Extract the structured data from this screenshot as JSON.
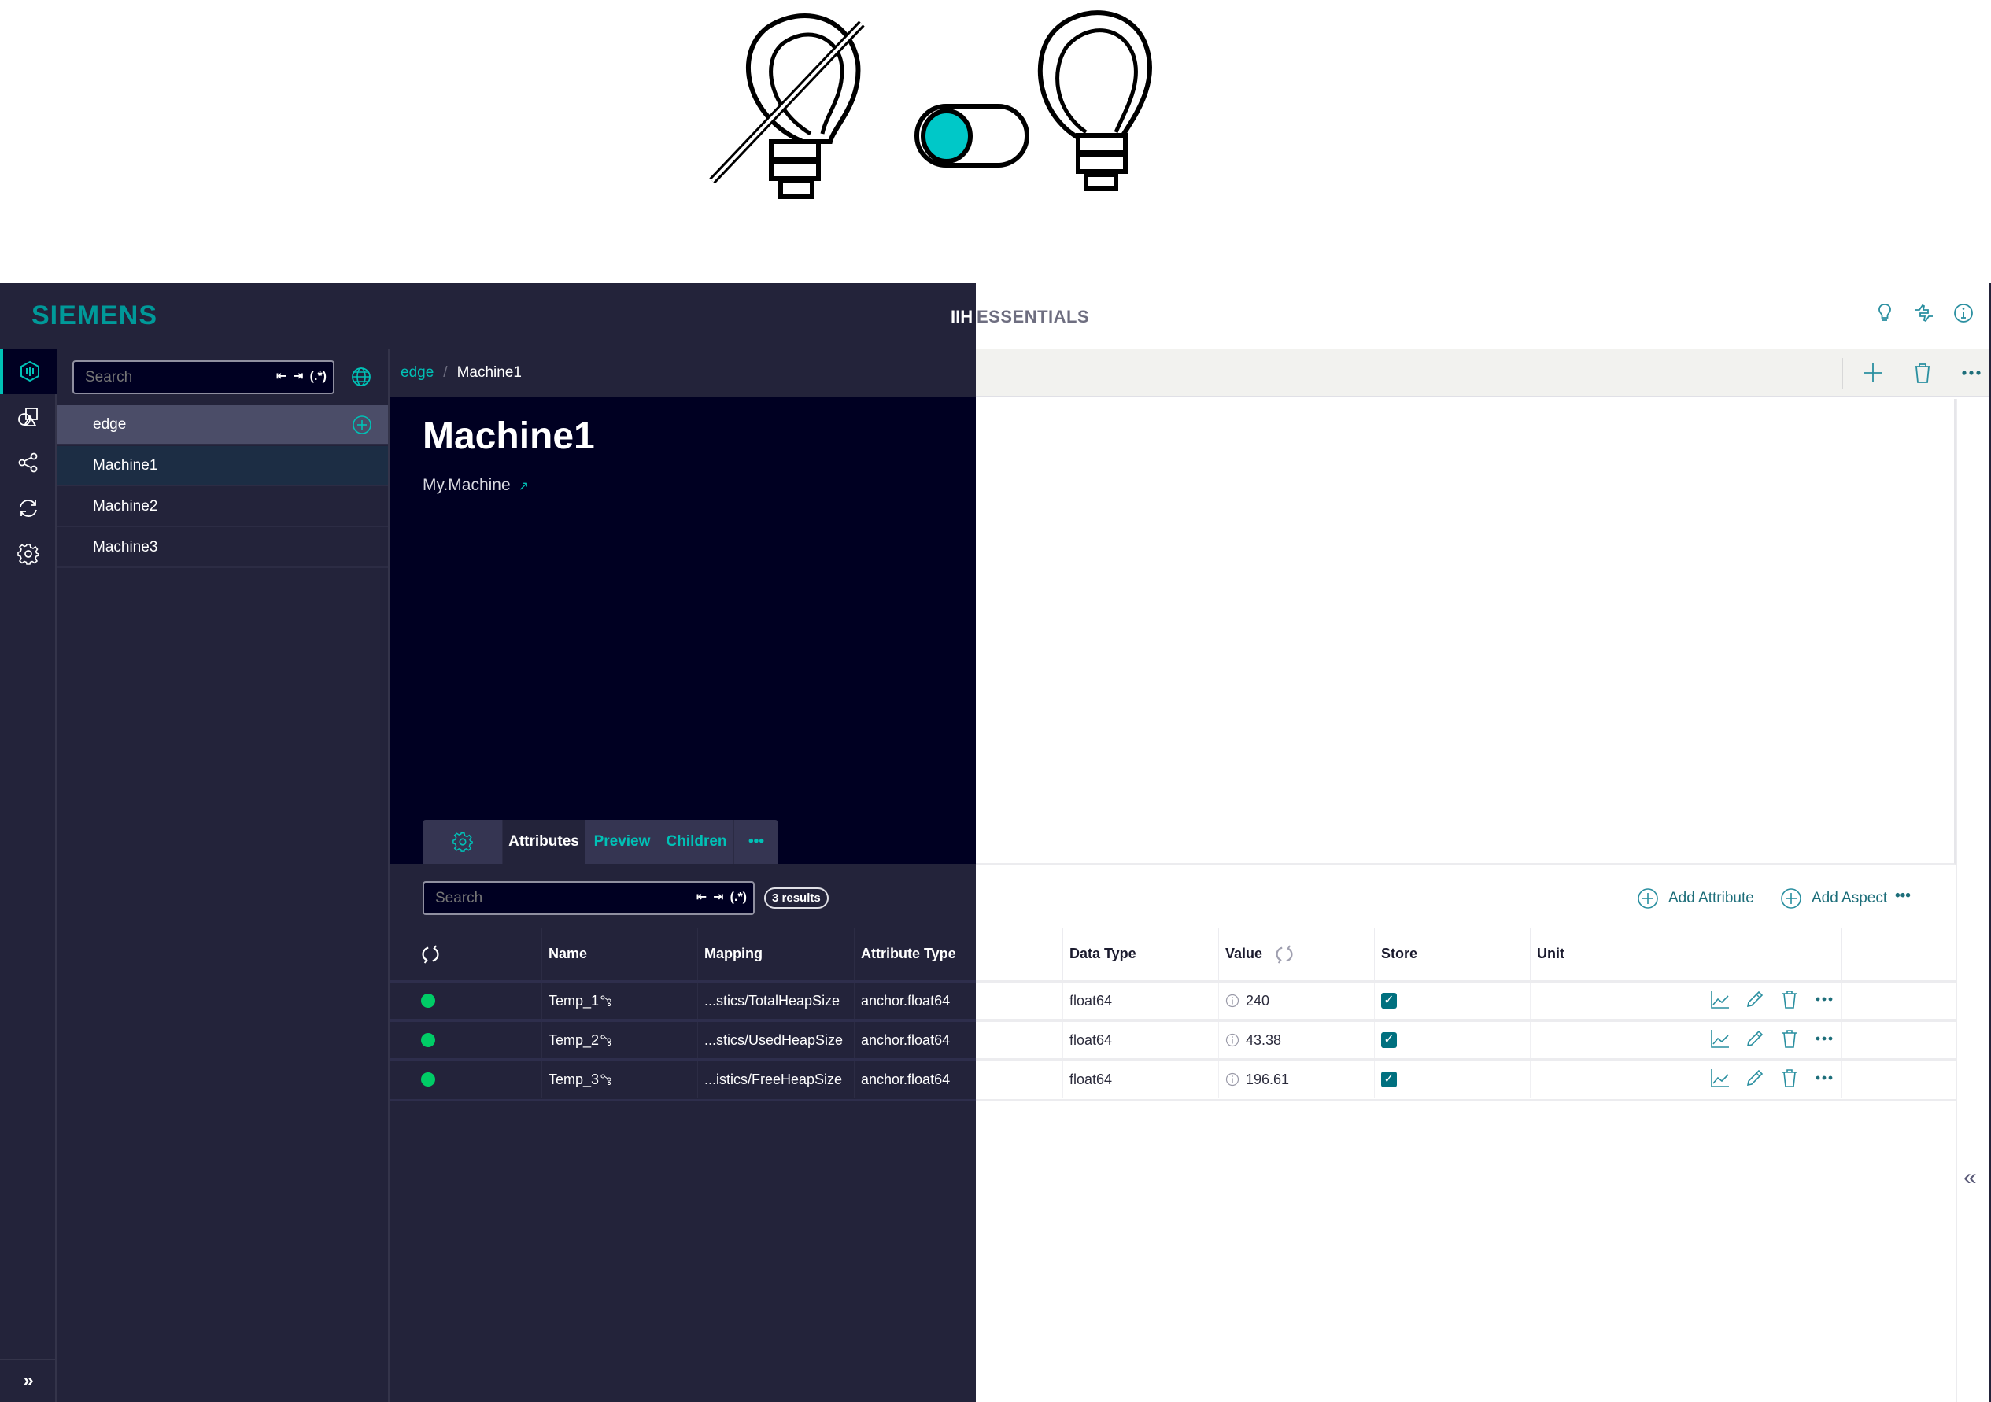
{
  "illustration": {
    "icons": [
      "light-off-icon",
      "toggle-icon",
      "light-on-icon"
    ],
    "toggle_accent": "#00c1c6"
  },
  "header": {
    "brand": "SIEMENS",
    "app_name_part1": "IIH",
    "app_name_part2": "ESSENTIALS",
    "icons": [
      "lightbulb-icon",
      "feedback-icon",
      "info-icon"
    ]
  },
  "rail": {
    "items": [
      {
        "icon": "asset-model-icon",
        "active": true
      },
      {
        "icon": "shapes-icon",
        "active": false
      },
      {
        "icon": "share-icon",
        "active": false
      },
      {
        "icon": "sync-icon",
        "active": false
      },
      {
        "icon": "settings-icon",
        "active": false
      }
    ],
    "expand_label": "»"
  },
  "tree": {
    "search_placeholder": "Search",
    "search_tools": [
      "⇤",
      "⇥",
      "(.*)"
    ],
    "items": [
      {
        "label": "edge",
        "type": "root"
      },
      {
        "label": "Machine1",
        "type": "selected"
      },
      {
        "label": "Machine2",
        "type": "normal"
      },
      {
        "label": "Machine3",
        "type": "normal"
      }
    ]
  },
  "breadcrumb": {
    "root": "edge",
    "separator": "/",
    "current": "Machine1"
  },
  "detail": {
    "title": "Machine1",
    "type": "My.Machine",
    "type_link_icon": "↗",
    "tabs": [
      {
        "label": "",
        "icon": "gear-icon"
      },
      {
        "label": "Attributes",
        "active": true
      },
      {
        "label": "Preview"
      },
      {
        "label": "Children"
      },
      {
        "label": "•••",
        "icon": "more-icon"
      }
    ],
    "search_placeholder": "Search",
    "results_badge": "3 results"
  },
  "actions": {
    "add_attribute": "Add Attribute",
    "add_aspect": "Add Aspect",
    "more": "•••"
  },
  "table": {
    "columns": [
      "",
      "Name",
      "Mapping",
      "Attribute Type",
      "Data Type",
      "Value",
      "Store",
      "Unit",
      ""
    ],
    "rows": [
      {
        "status": "connected",
        "name": "Temp_1",
        "mapping": "...stics/TotalHeapSize",
        "attribute_type": "anchor.float64",
        "data_type": "float64",
        "value": "240",
        "store": true,
        "unit": ""
      },
      {
        "status": "connected",
        "name": "Temp_2",
        "mapping": "...stics/UsedHeapSize",
        "attribute_type": "anchor.float64",
        "data_type": "float64",
        "value": "43.38",
        "store": true,
        "unit": ""
      },
      {
        "status": "connected",
        "name": "Temp_3",
        "mapping": "...istics/FreeHeapSize",
        "attribute_type": "anchor.float64",
        "data_type": "float64",
        "value": "196.61",
        "store": true,
        "unit": ""
      }
    ],
    "row_actions": [
      "trend-icon",
      "edit-icon",
      "delete-icon",
      "more-icon"
    ]
  },
  "colors": {
    "accent": "#00c1b6",
    "brand": "#009999",
    "dark_bg": "#23233a",
    "deep_bg": "#000022",
    "status_ok": "#00cc66",
    "checkbox": "#00707f"
  },
  "collapse_label": "«"
}
